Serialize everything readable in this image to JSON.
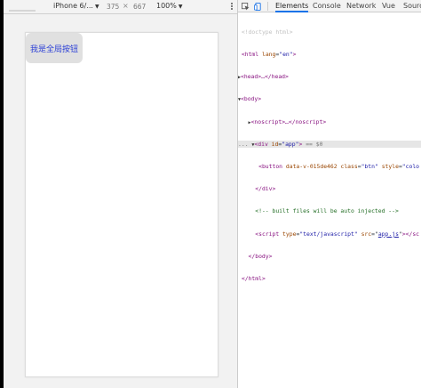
{
  "device_toolbar": {
    "device": "iPhone 6/...",
    "width": "375",
    "separator": "×",
    "height": "667",
    "zoom": "100%"
  },
  "page": {
    "global_button": "我是全局按钮"
  },
  "devtools": {
    "tabs": [
      "Elements",
      "Console",
      "Network",
      "Vue",
      "Sources"
    ]
  },
  "dom": {
    "doctype": "<!doctype html>",
    "html_open_tag": "<html",
    "html_lang_attr": "lang",
    "html_lang_val": "\"en\"",
    "head_collapsed": "<head>…</head>",
    "body_open": "<body>",
    "noscript_collapsed": "<noscript>…</noscript>",
    "div_tag": "<div",
    "div_id_attr": "id",
    "div_id_val": "\"app\"",
    "sel_marker": "== $0",
    "button_tag": "<button",
    "button_data_attr": "data-v-015de462",
    "button_class_attr": "class",
    "button_class_val": "\"btn\"",
    "button_style_attr": "style",
    "button_style_val": "\"colo",
    "div_close": "</div>",
    "comment": "<!-- built files will be auto injected -->",
    "script_tag": "<script",
    "script_type_attr": "type",
    "script_type_val": "\"text/javascript\"",
    "script_src_attr": "src",
    "script_src_val": "app.js",
    "script_close": "></sc",
    "body_close": "</body>",
    "html_close": "</html>",
    "ellipsis": "..."
  }
}
